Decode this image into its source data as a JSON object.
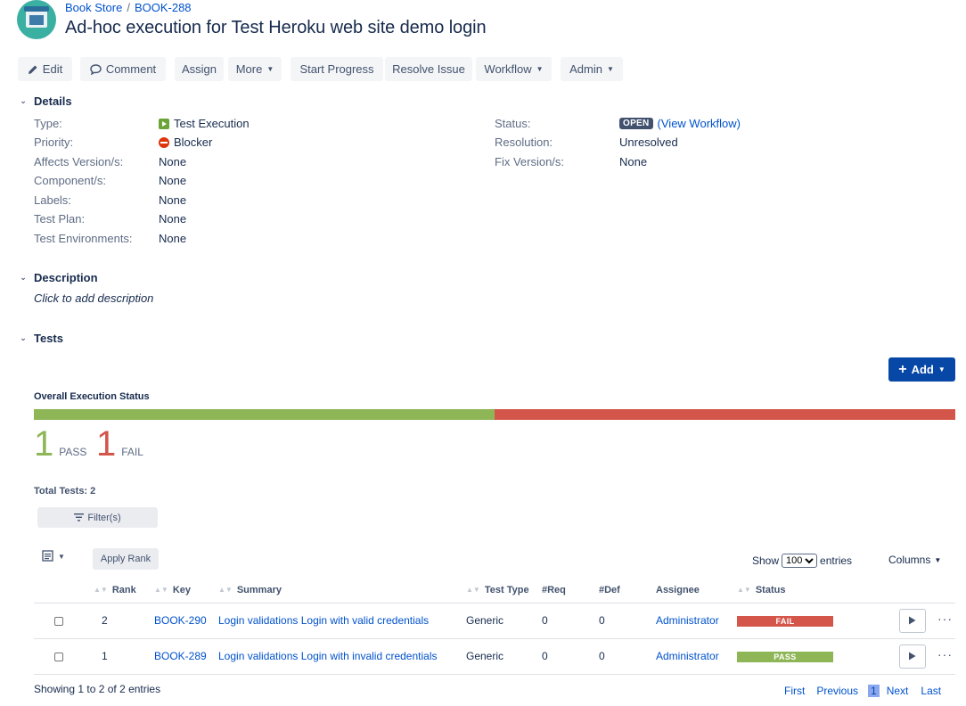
{
  "breadcrumb": {
    "project": "Book Store",
    "separator": "/",
    "issue_key": "BOOK-288"
  },
  "title": "Ad-hoc execution for Test Heroku web site demo login",
  "toolbar": {
    "edit": "Edit",
    "comment": "Comment",
    "assign": "Assign",
    "more": "More",
    "start_progress": "Start Progress",
    "resolve_issue": "Resolve Issue",
    "workflow": "Workflow",
    "admin": "Admin"
  },
  "details": {
    "heading": "Details",
    "type_label": "Type:",
    "type_value": "Test Execution",
    "priority_label": "Priority:",
    "priority_value": "Blocker",
    "affects_label": "Affects Version/s:",
    "affects_value": "None",
    "component_label": "Component/s:",
    "component_value": "None",
    "labels_label": "Labels:",
    "labels_value": "None",
    "testplan_label": "Test Plan:",
    "testplan_value": "None",
    "testenv_label": "Test Environments:",
    "testenv_value": "None",
    "status_label": "Status:",
    "status_value": "OPEN",
    "view_workflow": "(View Workflow)",
    "resolution_label": "Resolution:",
    "resolution_value": "Unresolved",
    "fixversion_label": "Fix Version/s:",
    "fixversion_value": "None"
  },
  "description": {
    "heading": "Description",
    "placeholder": "Click to add description"
  },
  "tests": {
    "heading": "Tests",
    "add_label": "Add",
    "overall_label": "Overall Execution Status",
    "pass_count": "1",
    "pass_label": "PASS",
    "fail_count": "1",
    "fail_label": "FAIL",
    "pass_fraction": 0.5,
    "total_label": "Total Tests: 2",
    "filter_label": "Filter(s)",
    "apply_rank": "Apply Rank",
    "show_label": "Show",
    "show_value": "100",
    "entries_label": "entries",
    "columns_label": "Columns",
    "headers": {
      "rank": "Rank",
      "key": "Key",
      "summary": "Summary",
      "test_type": "Test Type",
      "req": "#Req",
      "def": "#Def",
      "assignee": "Assignee",
      "status": "Status"
    },
    "rows": [
      {
        "rank": "2",
        "key": "BOOK-290",
        "summary": "Login validations Login with valid credentials",
        "test_type": "Generic",
        "req": "0",
        "def": "0",
        "assignee": "Administrator",
        "status": "FAIL"
      },
      {
        "rank": "1",
        "key": "BOOK-289",
        "summary": "Login validations Login with invalid credentials",
        "test_type": "Generic",
        "req": "0",
        "def": "0",
        "assignee": "Administrator",
        "status": "PASS"
      }
    ],
    "showing": "Showing 1 to 2 of 2 entries",
    "pager": {
      "first": "First",
      "previous": "Previous",
      "current": "1",
      "next": "Next",
      "last": "Last"
    }
  },
  "colors": {
    "pass": "#8eb656",
    "fail": "#d4564b",
    "accent": "#0052cc",
    "primary_button": "#0747a6"
  },
  "icons": {
    "edit": "pencil-icon",
    "comment": "speech-bubble-icon",
    "type": "test-execution-icon",
    "priority": "blocker-icon",
    "filter": "filter-icon",
    "run": "play-icon"
  }
}
